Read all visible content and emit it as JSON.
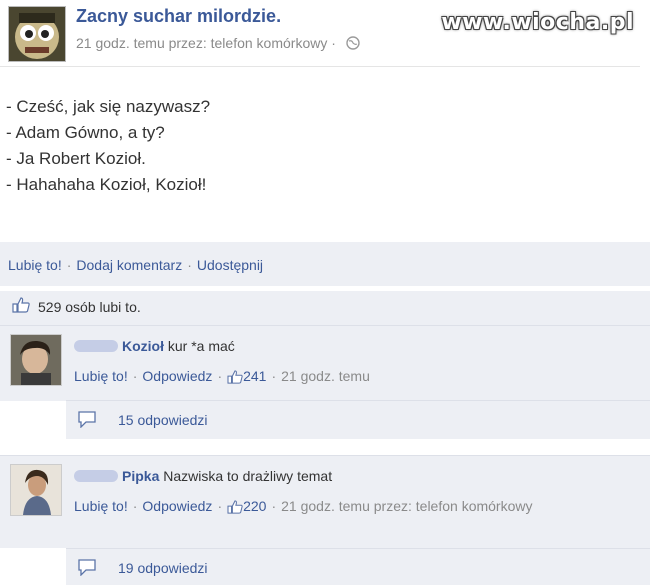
{
  "watermark": "www.wiocha.pl",
  "post": {
    "page_name": "Zacny suchar milordzie.",
    "meta": "21 godz. temu przez: telefon komórkowy ·",
    "lines": [
      "- Cześć, jak się nazywasz?",
      "- Adam Gówno, a ty?",
      "- Ja Robert Kozioł.",
      "- Hahahaha Kozioł, Kozioł!"
    ]
  },
  "actions": {
    "like": "Lubię to!",
    "comment": "Dodaj komentarz",
    "share": "Udostępnij",
    "separator": "·"
  },
  "likes_summary": "529 osób lubi to.",
  "comments": [
    {
      "name": "Kozioł",
      "text": "kur *a mać",
      "like": "Lubię to!",
      "reply": "Odpowiedz",
      "like_count": "241",
      "time": "21 godz. temu",
      "replies": "15 odpowiedzi"
    },
    {
      "name": "Pipka",
      "text": "Nazwiska to drażliwy temat",
      "like": "Lubię to!",
      "reply": "Odpowiedz",
      "like_count": "220",
      "time": "21 godz. temu przez: telefon komórkowy",
      "replies": "19 odpowiedzi"
    }
  ],
  "colors": {
    "link": "#3b5998",
    "panel": "#edeff4",
    "meta": "#8a8a8a"
  }
}
